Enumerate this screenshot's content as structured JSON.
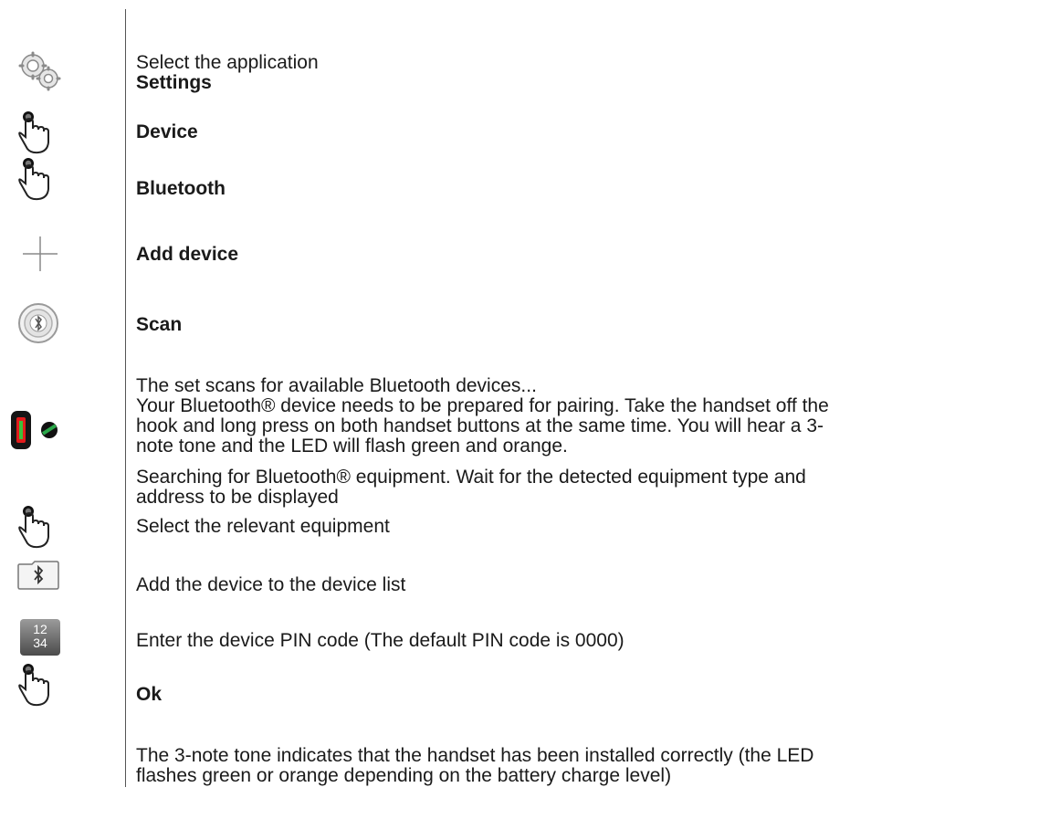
{
  "steps": {
    "s1_line1": "Select the application",
    "s1_line2": "Settings",
    "s2": "Device",
    "s3": "Bluetooth",
    "s4": "Add device",
    "s5": "Scan",
    "s6_line1": "The set scans for available Bluetooth devices...",
    "s6_line2": "Your Bluetooth® device needs to be prepared for pairing. Take the handset off the",
    "s6_line3": "hook and long press on both handset buttons at the same time. You will hear a 3-",
    "s6_line4": "note tone and the LED will flash green and orange.",
    "s7_line1": "Searching for Bluetooth® equipment. Wait for the detected equipment type and",
    "s7_line2": "address to be displayed",
    "s8": "Select the relevant equipment",
    "s9": "Add the device to the device list",
    "s10": "Enter the device PIN code (The default PIN code is 0000)",
    "s11": "Ok",
    "s12_line1": "The 3-note tone indicates that the handset has been installed correctly (the LED",
    "s12_line2": "flashes green or orange depending on the battery charge level)"
  },
  "keypad_icon": {
    "top": "12",
    "bottom": "34"
  },
  "icons": [
    "settings-gears-icon",
    "tap-hand-icon",
    "plus-icon",
    "bluetooth-scan-icon",
    "handset-led-icon",
    "bluetooth-folder-icon",
    "keypad-icon"
  ]
}
